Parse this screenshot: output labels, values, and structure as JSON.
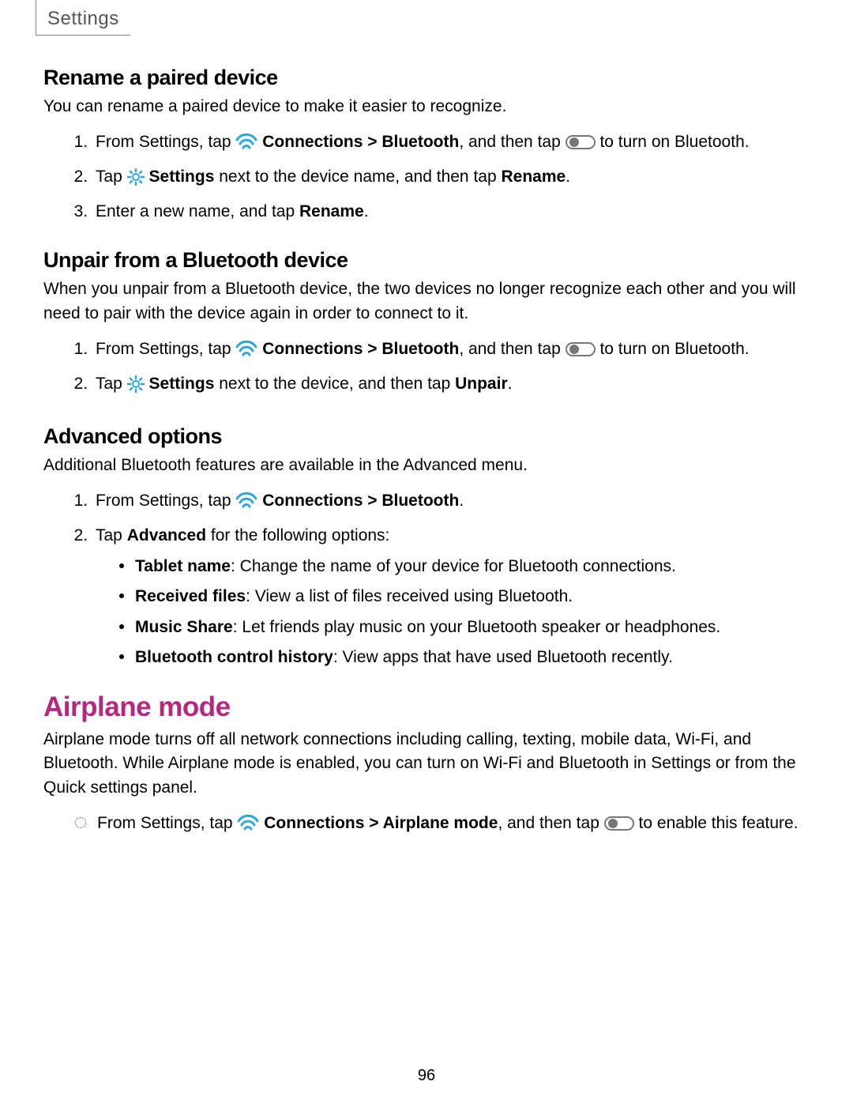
{
  "header": {
    "breadcrumb": "Settings"
  },
  "page_number": "96",
  "sections": {
    "rename": {
      "heading": "Rename a paired device",
      "intro": "You can rename a paired device to make it easier to recognize.",
      "step1_pre": "From Settings, tap ",
      "step1_bold1": "Connections > Bluetooth",
      "step1_mid": ", and then tap ",
      "step1_post": " to turn on Bluetooth.",
      "step2_pre": "Tap ",
      "step2_bold1": "Settings",
      "step2_mid": " next to the device name, and then tap ",
      "step2_bold2": "Rename",
      "step2_end": ".",
      "step3_pre": "Enter a new name, and tap ",
      "step3_bold": "Rename",
      "step3_end": "."
    },
    "unpair": {
      "heading": "Unpair from a Bluetooth device",
      "intro": "When you unpair from a Bluetooth device, the two devices no longer recognize each other and you will need to pair with the device again in order to connect to it.",
      "step1_pre": "From Settings, tap ",
      "step1_bold1": "Connections > Bluetooth",
      "step1_mid": ", and then tap ",
      "step1_post": " to turn on Bluetooth.",
      "step2_pre": "Tap ",
      "step2_bold1": "Settings",
      "step2_mid": " next to the device, and then tap ",
      "step2_bold2": "Unpair",
      "step2_end": "."
    },
    "advanced": {
      "heading": "Advanced options",
      "intro": "Additional Bluetooth features are available in the Advanced menu.",
      "step1_pre": "From Settings, tap ",
      "step1_bold1": "Connections > Bluetooth",
      "step1_end": ".",
      "step2_pre": "Tap ",
      "step2_bold1": "Advanced",
      "step2_post": " for the following options:",
      "bullets": {
        "b1_label": "Tablet name",
        "b1_text": ": Change the name of your device for Bluetooth connections.",
        "b2_label": "Received files",
        "b2_text": ": View a list of files received using Bluetooth.",
        "b3_label": "Music Share",
        "b3_text": ": Let friends play music on your Bluetooth speaker or headphones.",
        "b4_label": "Bluetooth control history",
        "b4_text": ": View apps that have used Bluetooth recently."
      }
    },
    "airplane": {
      "heading": "Airplane mode",
      "intro": "Airplane mode turns off all network connections including calling, texting, mobile data, Wi-Fi, and Bluetooth. While Airplane mode is enabled, you can turn on Wi-Fi and Bluetooth in Settings or from the Quick settings panel.",
      "step_pre": "From Settings, tap ",
      "step_bold1": "Connections > Airplane mode",
      "step_mid": ", and then tap ",
      "step_post": " to enable this feature."
    }
  }
}
